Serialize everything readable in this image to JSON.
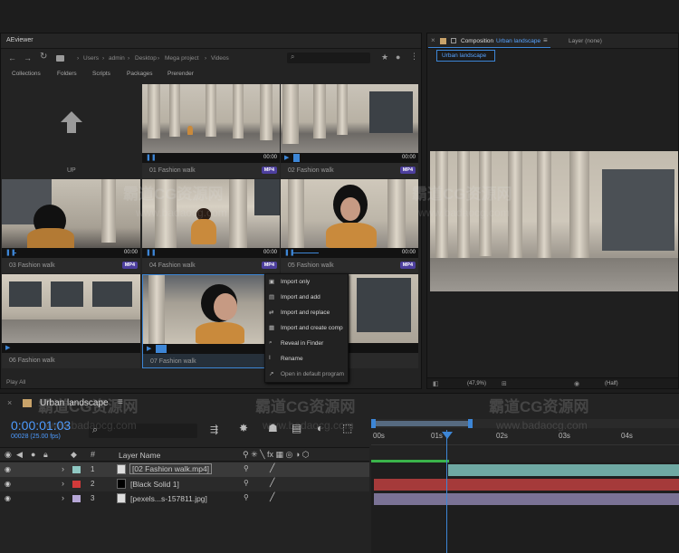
{
  "aeviewer": {
    "title": "AEviewer",
    "breadcrumb": [
      "Users",
      "admin",
      "Desktop",
      "Mega project",
      "Videos"
    ],
    "tabs": [
      "Collections",
      "Folders",
      "Scripts",
      "Packages",
      "Prerender"
    ],
    "up_label": "UP",
    "play_all": "Play All",
    "thumbnails": [
      {
        "label": "01 Fashion walk",
        "time": "00:00",
        "badge": "MP4"
      },
      {
        "label": "02 Fashion walk",
        "time": "00:00",
        "badge": "MP4"
      },
      {
        "label": "03 Fashion walk",
        "time": "00:00",
        "badge": "MP4"
      },
      {
        "label": "04 Fashion walk",
        "time": "00:00",
        "badge": "MP4"
      },
      {
        "label": "05 Fashion walk",
        "time": "00:00",
        "badge": "MP4"
      },
      {
        "label": "06 Fashion walk",
        "time": "",
        "badge": ""
      },
      {
        "label": "07 Fashion walk",
        "time": "",
        "badge": ""
      }
    ],
    "context_menu": [
      "Import only",
      "Import and add",
      "Import and replace",
      "Import and create comp",
      "Reveal in Finder",
      "Rename",
      "Open in default program"
    ]
  },
  "composition": {
    "title_prefix": "Composition",
    "title_name": "Urban landscape",
    "layer_label": "Layer (none)",
    "tab": "Urban landscape",
    "zoom": "(47,9%)",
    "resolution": "(Half)"
  },
  "timeline": {
    "comp_name": "Urban landscape",
    "timecode": "0:00:01:03",
    "frames": "00028 (25.00 fps)",
    "col_layer_name": "Layer Name",
    "ruler": [
      "00s",
      "01s",
      "02s",
      "03s",
      "04s"
    ],
    "layers": [
      {
        "num": "1",
        "name": "[02 Fashion walk.mp4]",
        "color": "#8fc8c3"
      },
      {
        "num": "2",
        "name": "[Black Solid 1]",
        "color": "#d23a3a"
      },
      {
        "num": "3",
        "name": "[pexels...s-157811.jpg]",
        "color": "#b6a7d6"
      }
    ]
  },
  "watermark": {
    "brand": "霸道CG资源网",
    "url": "www.badaocg.com"
  }
}
